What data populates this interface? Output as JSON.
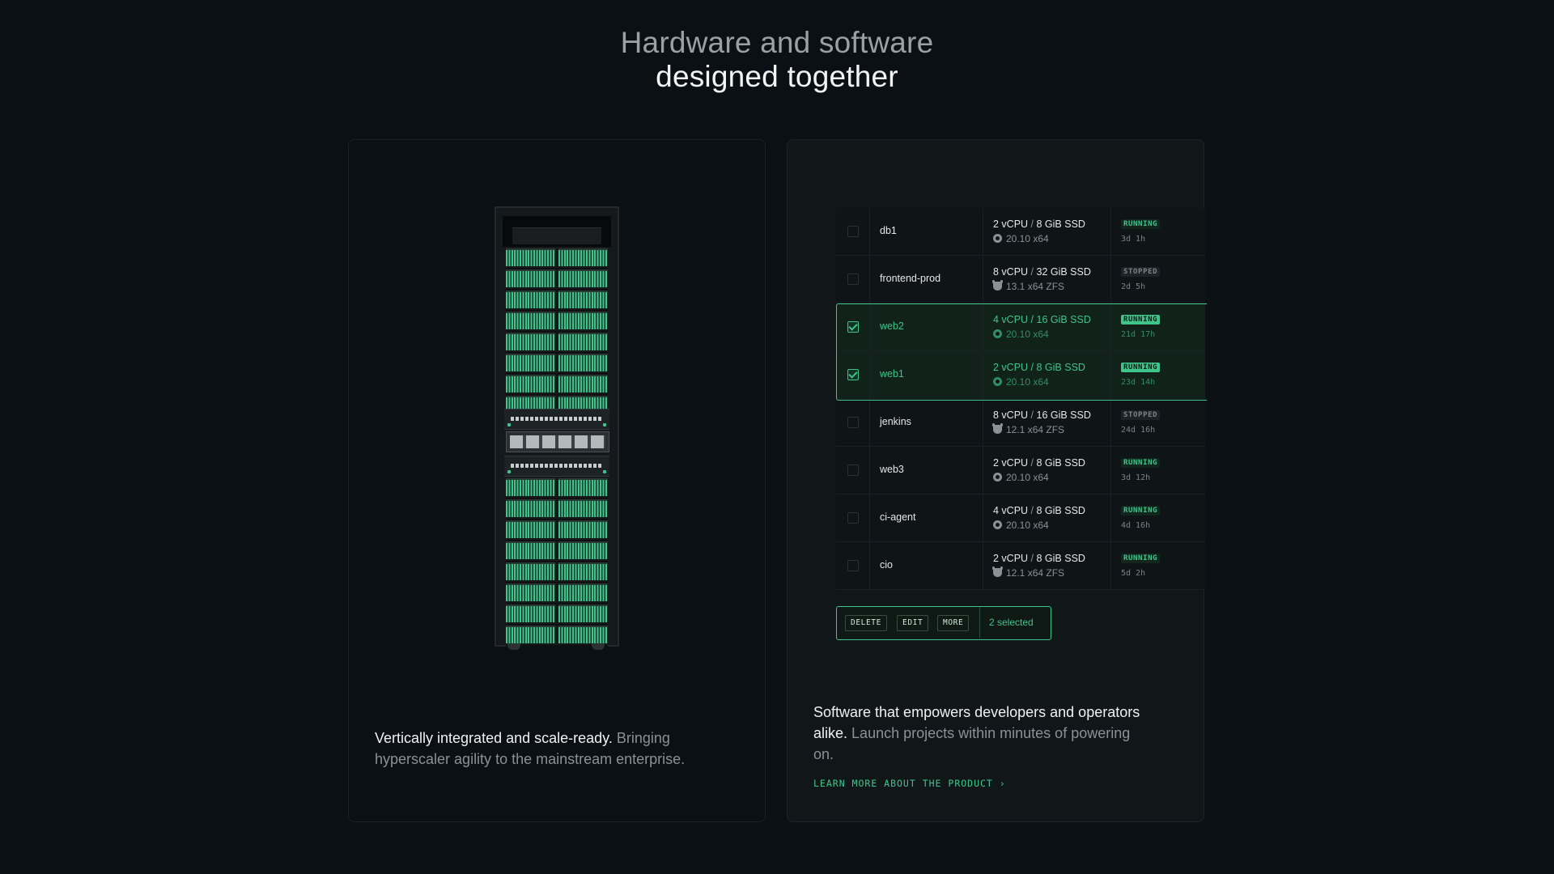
{
  "headline": {
    "line1": "Hardware and software",
    "line2": "designed together"
  },
  "hardware_card": {
    "text_strong": "Vertically integrated and scale-ready.",
    "text_muted": "Bringing hyperscaler agility to the mainstream enterprise."
  },
  "software_card": {
    "text_strong": "Software that empowers developers and operators alike.",
    "text_muted": "Launch projects within minutes of powering on.",
    "link": "LEARN MORE ABOUT THE PRODUCT ›"
  },
  "instances": [
    {
      "name": "db1",
      "cpu": "2 vCPU",
      "storage": "8 GiB SSD",
      "os_icon": "ubuntu-icon",
      "os": "20.10 x64",
      "status": "RUNNING",
      "uptime": "3d 1h",
      "selected": false
    },
    {
      "name": "frontend-prod",
      "cpu": "8 vCPU",
      "storage": "32 GiB SSD",
      "os_icon": "bsd-icon",
      "os": "13.1 x64 ZFS",
      "status": "STOPPED",
      "uptime": "2d 5h",
      "selected": false
    },
    {
      "name": "web2",
      "cpu": "4 vCPU",
      "storage": "16 GiB SSD",
      "os_icon": "ubuntu-icon",
      "os": "20.10 x64",
      "status": "RUNNING",
      "uptime": "21d 17h",
      "selected": true
    },
    {
      "name": "web1",
      "cpu": "2 vCPU",
      "storage": "8 GiB SSD",
      "os_icon": "ubuntu-icon",
      "os": "20.10 x64",
      "status": "RUNNING",
      "uptime": "23d 14h",
      "selected": true
    },
    {
      "name": "jenkins",
      "cpu": "8 vCPU",
      "storage": "16 GiB SSD",
      "os_icon": "bsd-icon",
      "os": "12.1 x64 ZFS",
      "status": "STOPPED",
      "uptime": "24d 16h",
      "selected": false
    },
    {
      "name": "web3",
      "cpu": "2 vCPU",
      "storage": "8 GiB SSD",
      "os_icon": "ubuntu-icon",
      "os": "20.10 x64",
      "status": "RUNNING",
      "uptime": "3d 12h",
      "selected": false
    },
    {
      "name": "ci-agent",
      "cpu": "4 vCPU",
      "storage": "8 GiB SSD",
      "os_icon": "ubuntu-icon",
      "os": "20.10 x64",
      "status": "RUNNING",
      "uptime": "4d 16h",
      "selected": false
    },
    {
      "name": "cio",
      "cpu": "2 vCPU",
      "storage": "8 GiB SSD",
      "os_icon": "bsd-icon",
      "os": "12.1 x64 ZFS",
      "status": "RUNNING",
      "uptime": "5d 2h",
      "selected": false
    }
  ],
  "action_bar": {
    "delete": "DELETE",
    "edit": "EDIT",
    "more": "MORE",
    "selected_count": "2 selected"
  },
  "colors": {
    "background": "#0b1014",
    "accent": "#3fc58a",
    "muted": "#8b9196"
  }
}
